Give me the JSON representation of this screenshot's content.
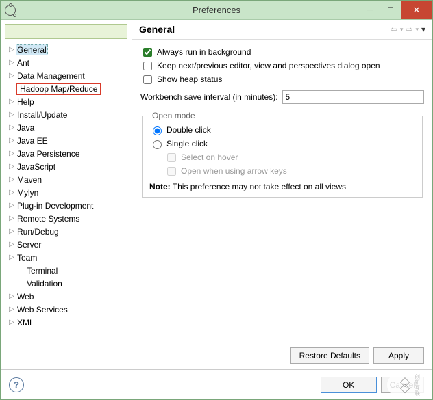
{
  "window": {
    "title": "Preferences"
  },
  "tree": {
    "items": [
      {
        "label": "General",
        "selected": true,
        "expandable": true
      },
      {
        "label": "Ant",
        "expandable": true
      },
      {
        "label": "Data Management",
        "expandable": true
      },
      {
        "label": "Hadoop Map/Reduce",
        "highlighted": true,
        "expandable": false
      },
      {
        "label": "Help",
        "expandable": true
      },
      {
        "label": "Install/Update",
        "expandable": true
      },
      {
        "label": "Java",
        "expandable": true
      },
      {
        "label": "Java EE",
        "expandable": true
      },
      {
        "label": "Java Persistence",
        "expandable": true
      },
      {
        "label": "JavaScript",
        "expandable": true
      },
      {
        "label": "Maven",
        "expandable": true
      },
      {
        "label": "Mylyn",
        "expandable": true
      },
      {
        "label": "Plug-in Development",
        "expandable": true
      },
      {
        "label": "Remote Systems",
        "expandable": true
      },
      {
        "label": "Run/Debug",
        "expandable": true
      },
      {
        "label": "Server",
        "expandable": true
      },
      {
        "label": "Team",
        "expandable": true
      },
      {
        "label": "Terminal",
        "sub": true,
        "expandable": false
      },
      {
        "label": "Validation",
        "sub": true,
        "expandable": false
      },
      {
        "label": "Web",
        "expandable": true
      },
      {
        "label": "Web Services",
        "expandable": true
      },
      {
        "label": "XML",
        "expandable": true
      }
    ]
  },
  "page": {
    "heading": "General",
    "checks": {
      "always_bg": {
        "label": "Always run in background",
        "checked": true
      },
      "keep_editor": {
        "label": "Keep next/previous editor, view and perspectives dialog open",
        "checked": false
      },
      "heap": {
        "label": "Show heap status",
        "checked": false
      }
    },
    "interval": {
      "label": "Workbench save interval (in minutes):",
      "value": "5"
    },
    "openmode": {
      "legend": "Open mode",
      "double": "Double click",
      "single": "Single click",
      "selected": "double",
      "hover": {
        "label": "Select on hover",
        "checked": false
      },
      "arrow": {
        "label": "Open when using arrow keys",
        "checked": false
      },
      "note_label": "Note:",
      "note_text": " This preference may not take effect on all views"
    },
    "buttons": {
      "restore": "Restore Defaults",
      "apply": "Apply"
    }
  },
  "bottom": {
    "ok": "OK",
    "cancel": "Cancel"
  },
  "watermark": "创新互联"
}
